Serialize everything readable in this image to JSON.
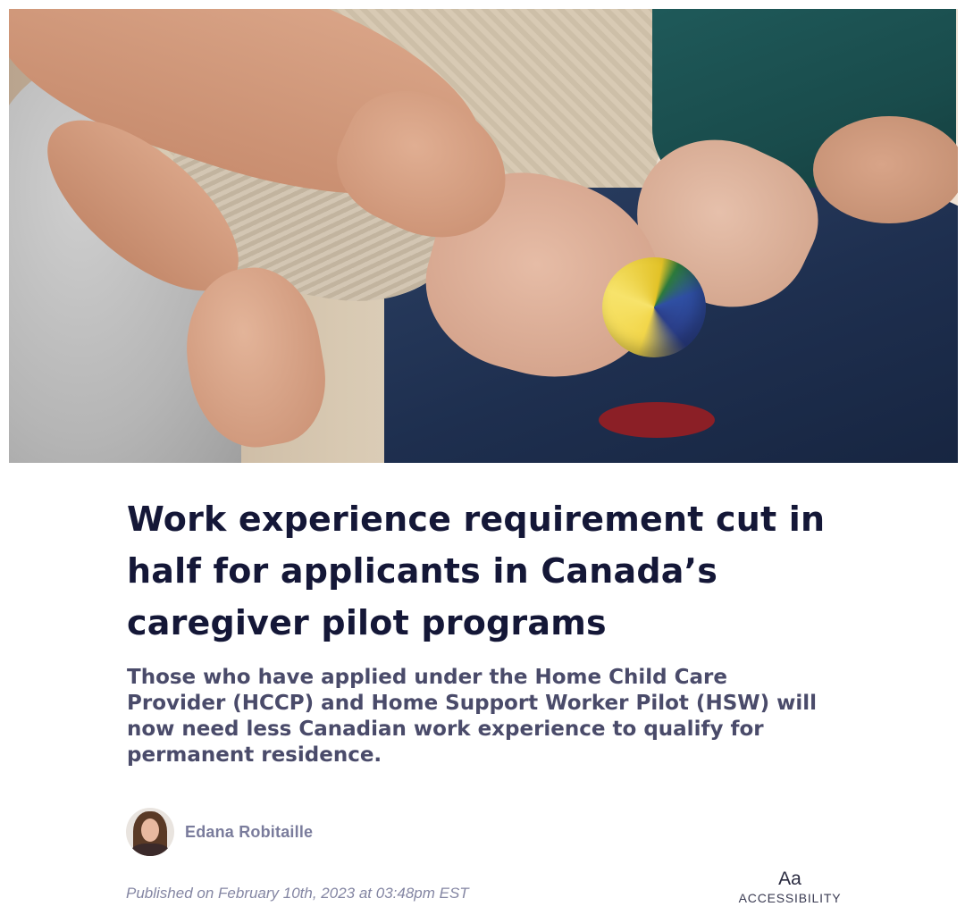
{
  "article": {
    "hero_image": "hero-photo-caregiver-hands",
    "headline": "Work experience requirement cut in half for applicants in Canada’s caregiver pilot programs",
    "subheadline": "Those who have applied under the Home Child Care Provider (HCCP) and Home Support Worker Pilot (HSW) will now need less Canadian work experience to qualify for permanent residence.",
    "author": {
      "name": "Edana Robitaille",
      "avatar": "author-avatar"
    },
    "published": "Published on February 10th, 2023 at 03:48pm EST"
  },
  "accessibility": {
    "icon_text": "Aa",
    "label": "ACCESSIBILITY"
  },
  "colors": {
    "headline": "#141737",
    "subheadline": "#4a4b6a",
    "meta": "#8486a3"
  }
}
